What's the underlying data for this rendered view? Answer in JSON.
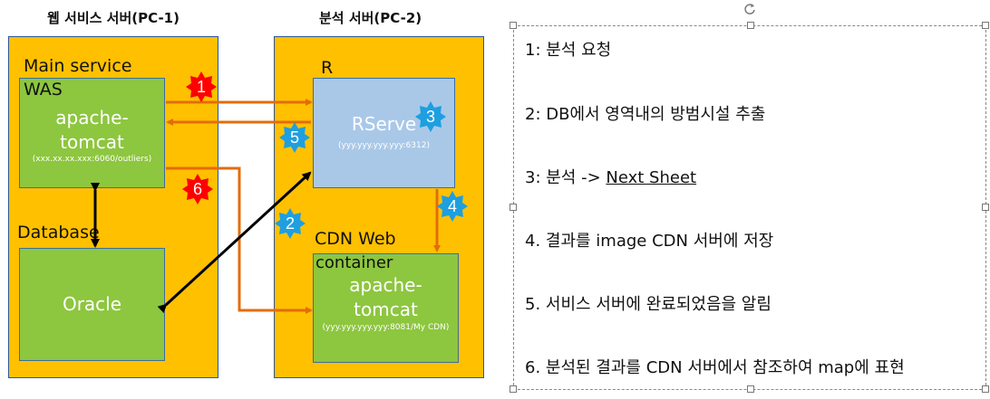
{
  "headers": {
    "pc1": "웹 서비스 서버(PC-1)",
    "pc2": "분석 서버(PC-2)"
  },
  "pc1": {
    "main_service": "Main service",
    "was": "WAS",
    "tomcat_line1": "apache-",
    "tomcat_line2": "tomcat",
    "tomcat_addr": "(xxx.xx.xx.xxx:6060/outliers)",
    "database": "Database",
    "oracle": "Oracle"
  },
  "pc2": {
    "r": "R",
    "rserve": "RServe",
    "rserve_addr": "(yyy.yyy.yyy.yyy:6312)",
    "cdn_web": "CDN Web",
    "container": "container",
    "tomcat_line1": "apache-",
    "tomcat_line2": "tomcat",
    "tomcat_addr": "(yyy.yyy.yyy.yyy:8081/My CDN)"
  },
  "badges": {
    "b1": "1",
    "b2": "2",
    "b3": "3",
    "b4": "4",
    "b5": "5",
    "b6": "6"
  },
  "colors": {
    "panel": "#ffc000",
    "green_box": "#8dc63f",
    "blue_box": "#a9c8e8",
    "arrow_orange": "#e46c0a",
    "badge_red": "#ff0000",
    "badge_blue": "#1e9fe0"
  },
  "steps": {
    "s1": "1: 분석 요청",
    "s2": "2: DB에서 영역내의 방범시설 추출",
    "s3_prefix": "3: 분석 -> ",
    "s3_link": "Next Sheet",
    "s4": "4. 결과를 image CDN 서버에 저장",
    "s5": "5. 서비스 서버에 완료되었음을 알림",
    "s6": "6. 분석된 결과를 CDN 서버에서 참조하여 map에 표현"
  }
}
